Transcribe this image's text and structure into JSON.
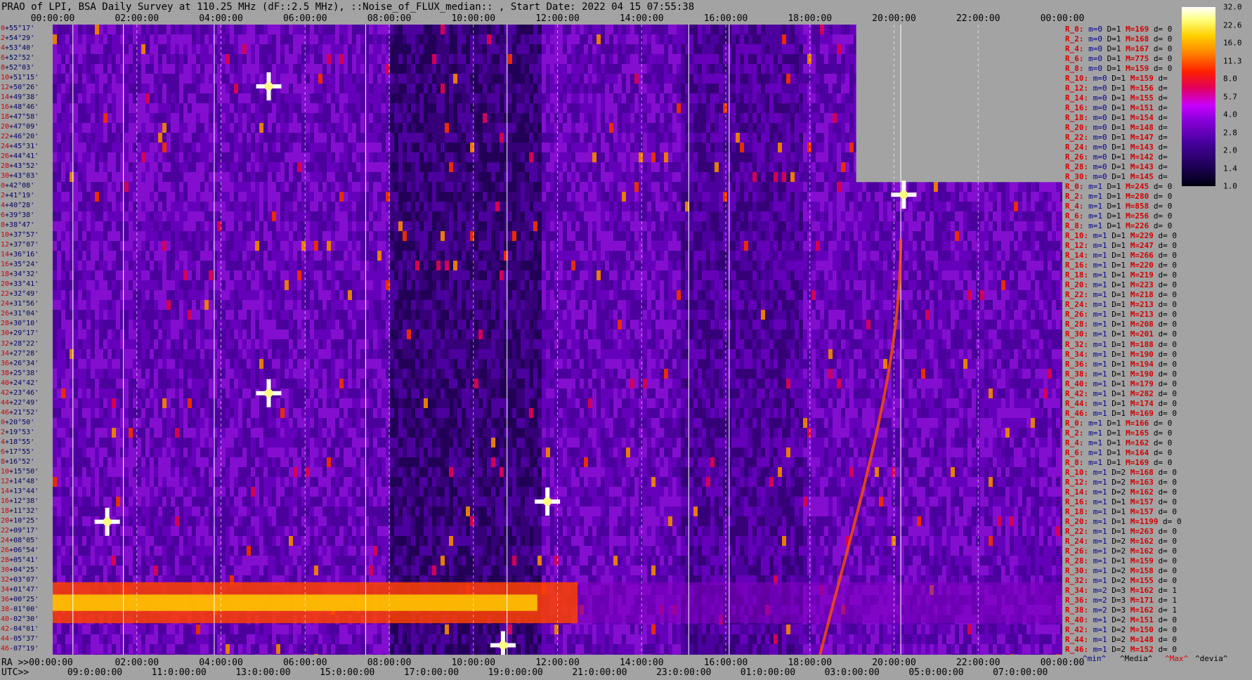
{
  "title": "PRAO of LPI, BSA Daily Survey at 110.25 MHz (dF::2.5 MHz), ::Noise_of_FLUX_median:: , Start Date: 2022 04 15 07:55:38",
  "top_ticks": [
    "00:00:00",
    "02:00:00",
    "04:00:00",
    "06:00:00",
    "08:00:00",
    "10:00:00",
    "12:00:00",
    "14:00:00",
    "16:00:00",
    "18:00:00",
    "20:00:00",
    "22:00:00",
    "00:00:00"
  ],
  "dec_labels": [
    {
      "i": "0",
      "d": "+55°17'"
    },
    {
      "i": "2",
      "d": "+54°29'"
    },
    {
      "i": "4",
      "d": "+53°40'"
    },
    {
      "i": "6",
      "d": "+52°52'"
    },
    {
      "i": "8",
      "d": "+52°03'"
    },
    {
      "i": "10",
      "d": "+51°15'"
    },
    {
      "i": "12",
      "d": "+50°26'"
    },
    {
      "i": "14",
      "d": "+49°38'"
    },
    {
      "i": "16",
      "d": "+48°46'"
    },
    {
      "i": "18",
      "d": "+47°58'"
    },
    {
      "i": "20",
      "d": "+47°09'"
    },
    {
      "i": "22",
      "d": "+46°20'"
    },
    {
      "i": "24",
      "d": "+45°31'"
    },
    {
      "i": "26",
      "d": "+44°41'"
    },
    {
      "i": "28",
      "d": "+43°52'"
    },
    {
      "i": "30",
      "d": "+43°03'"
    },
    {
      "i": "0",
      "d": "+42°08'"
    },
    {
      "i": "2",
      "d": "+41°19'"
    },
    {
      "i": "4",
      "d": "+40°28'"
    },
    {
      "i": "6",
      "d": "+39°38'"
    },
    {
      "i": "8",
      "d": "+38°47'"
    },
    {
      "i": "10",
      "d": "+37°57'"
    },
    {
      "i": "12",
      "d": "+37°07'"
    },
    {
      "i": "14",
      "d": "+36°16'"
    },
    {
      "i": "16",
      "d": "+35°24'"
    },
    {
      "i": "18",
      "d": "+34°32'"
    },
    {
      "i": "20",
      "d": "+33°41'"
    },
    {
      "i": "22",
      "d": "+32°49'"
    },
    {
      "i": "24",
      "d": "+31°56'"
    },
    {
      "i": "26",
      "d": "+31°04'"
    },
    {
      "i": "28",
      "d": "+30°10'"
    },
    {
      "i": "30",
      "d": "+29°17'"
    },
    {
      "i": "32",
      "d": "+28°22'"
    },
    {
      "i": "34",
      "d": "+27°28'"
    },
    {
      "i": "36",
      "d": "+26°34'"
    },
    {
      "i": "38",
      "d": "+25°38'"
    },
    {
      "i": "40",
      "d": "+24°42'"
    },
    {
      "i": "42",
      "d": "+23°46'"
    },
    {
      "i": "44",
      "d": "+22°49'"
    },
    {
      "i": "46",
      "d": "+21°52'"
    },
    {
      "i": "0",
      "d": "+20°50'"
    },
    {
      "i": "2",
      "d": "+19°53'"
    },
    {
      "i": "4",
      "d": "+18°55'"
    },
    {
      "i": "6",
      "d": "+17°55'"
    },
    {
      "i": "8",
      "d": "+16°52'"
    },
    {
      "i": "10",
      "d": "+15°50'"
    },
    {
      "i": "12",
      "d": "+14°48'"
    },
    {
      "i": "14",
      "d": "+13°44'"
    },
    {
      "i": "16",
      "d": "+12°38'"
    },
    {
      "i": "18",
      "d": "+11°32'"
    },
    {
      "i": "20",
      "d": "+10°25'"
    },
    {
      "i": "22",
      "d": "+09°17'"
    },
    {
      "i": "24",
      "d": "+08°05'"
    },
    {
      "i": "26",
      "d": "+06°54'"
    },
    {
      "i": "28",
      "d": "+05°41'"
    },
    {
      "i": "30",
      "d": "+04°25'"
    },
    {
      "i": "32",
      "d": "+03°07'"
    },
    {
      "i": "34",
      "d": "+01°47'"
    },
    {
      "i": "36",
      "d": "+00°25'"
    },
    {
      "i": "38",
      "d": "-01°00'"
    },
    {
      "i": "40",
      "d": "-02°30'"
    },
    {
      "i": "42",
      "d": "-04°01'"
    },
    {
      "i": "44",
      "d": "-05°37'"
    },
    {
      "i": "46",
      "d": "-07°19'"
    }
  ],
  "right_rows": [
    {
      "r": "R_0:",
      "m": "m=0",
      "d": "D=1",
      "x": "M=169",
      "e": "d= 0"
    },
    {
      "r": "R_2:",
      "m": "m=0",
      "d": "D=1",
      "x": "M=168",
      "e": "d= 0"
    },
    {
      "r": "R_4:",
      "m": "m=0",
      "d": "D=1",
      "x": "M=167",
      "e": "d= 0"
    },
    {
      "r": "R_6:",
      "m": "m=0",
      "d": "D=1",
      "x": "M=775",
      "e": "d= 0"
    },
    {
      "r": "R_8:",
      "m": "m=0",
      "d": "D=1",
      "x": "M=159",
      "e": "d= 0"
    },
    {
      "r": "R_10:",
      "m": "m=0",
      "d": "D=1",
      "x": "M=159",
      "e": "d="
    },
    {
      "r": "R_12:",
      "m": "m=0",
      "d": "D=1",
      "x": "M=156",
      "e": "d="
    },
    {
      "r": "R_14:",
      "m": "m=0",
      "d": "D=1",
      "x": "M=155",
      "e": "d="
    },
    {
      "r": "R_16:",
      "m": "m=0",
      "d": "D=1",
      "x": "M=151",
      "e": "d="
    },
    {
      "r": "R_18:",
      "m": "m=0",
      "d": "D=1",
      "x": "M=154",
      "e": "d="
    },
    {
      "r": "R_20:",
      "m": "m=0",
      "d": "D=1",
      "x": "M=148",
      "e": "d="
    },
    {
      "r": "R_22:",
      "m": "m=0",
      "d": "D=1",
      "x": "M=147",
      "e": "d="
    },
    {
      "r": "R_24:",
      "m": "m=0",
      "d": "D=1",
      "x": "M=143",
      "e": "d="
    },
    {
      "r": "R_26:",
      "m": "m=0",
      "d": "D=1",
      "x": "M=142",
      "e": "d="
    },
    {
      "r": "R_28:",
      "m": "m=0",
      "d": "D=1",
      "x": "M=143",
      "e": "d="
    },
    {
      "r": "R_30:",
      "m": "m=0",
      "d": "D=1",
      "x": "M=145",
      "e": "d="
    },
    {
      "r": "R_0:",
      "m": "m=1",
      "d": "D=1",
      "x": "M=245",
      "e": "d= 0"
    },
    {
      "r": "R_2:",
      "m": "m=1",
      "d": "D=1",
      "x": "M=280",
      "e": "d= 0"
    },
    {
      "r": "R_4:",
      "m": "m=1",
      "d": "D=1",
      "x": "M=858",
      "e": "d= 0"
    },
    {
      "r": "R_6:",
      "m": "m=1",
      "d": "D=1",
      "x": "M=256",
      "e": "d= 0"
    },
    {
      "r": "R_8:",
      "m": "m=1",
      "d": "D=1",
      "x": "M=226",
      "e": "d= 0"
    },
    {
      "r": "R_10:",
      "m": "m=1",
      "d": "D=1",
      "x": "M=229",
      "e": "d= 0"
    },
    {
      "r": "R_12:",
      "m": "m=1",
      "d": "D=1",
      "x": "M=247",
      "e": "d= 0"
    },
    {
      "r": "R_14:",
      "m": "m=1",
      "d": "D=1",
      "x": "M=266",
      "e": "d= 0"
    },
    {
      "r": "R_16:",
      "m": "m=1",
      "d": "D=1",
      "x": "M=220",
      "e": "d= 0"
    },
    {
      "r": "R_18:",
      "m": "m=1",
      "d": "D=1",
      "x": "M=219",
      "e": "d= 0"
    },
    {
      "r": "R_20:",
      "m": "m=1",
      "d": "D=1",
      "x": "M=223",
      "e": "d= 0"
    },
    {
      "r": "R_22:",
      "m": "m=1",
      "d": "D=1",
      "x": "M=218",
      "e": "d= 0"
    },
    {
      "r": "R_24:",
      "m": "m=1",
      "d": "D=1",
      "x": "M=213",
      "e": "d= 0"
    },
    {
      "r": "R_26:",
      "m": "m=1",
      "d": "D=1",
      "x": "M=213",
      "e": "d= 0"
    },
    {
      "r": "R_28:",
      "m": "m=1",
      "d": "D=1",
      "x": "M=208",
      "e": "d= 0"
    },
    {
      "r": "R_30:",
      "m": "m=1",
      "d": "D=1",
      "x": "M=201",
      "e": "d= 0"
    },
    {
      "r": "R_32:",
      "m": "m=1",
      "d": "D=1",
      "x": "M=188",
      "e": "d= 0"
    },
    {
      "r": "R_34:",
      "m": "m=1",
      "d": "D=1",
      "x": "M=190",
      "e": "d= 0"
    },
    {
      "r": "R_36:",
      "m": "m=1",
      "d": "D=1",
      "x": "M=194",
      "e": "d= 0"
    },
    {
      "r": "R_38:",
      "m": "m=1",
      "d": "D=1",
      "x": "M=190",
      "e": "d= 0"
    },
    {
      "r": "R_40:",
      "m": "m=1",
      "d": "D=1",
      "x": "M=179",
      "e": "d= 0"
    },
    {
      "r": "R_42:",
      "m": "m=1",
      "d": "D=1",
      "x": "M=282",
      "e": "d= 0"
    },
    {
      "r": "R_44:",
      "m": "m=1",
      "d": "D=1",
      "x": "M=174",
      "e": "d= 0"
    },
    {
      "r": "R_46:",
      "m": "m=1",
      "d": "D=1",
      "x": "M=169",
      "e": "d= 0"
    },
    {
      "r": "R_0:",
      "m": "m=1",
      "d": "D=1",
      "x": "M=166",
      "e": "d= 0"
    },
    {
      "r": "R_2:",
      "m": "m=1",
      "d": "D=1",
      "x": "M=165",
      "e": "d= 0"
    },
    {
      "r": "R_4:",
      "m": "m=1",
      "d": "D=1",
      "x": "M=162",
      "e": "d= 0"
    },
    {
      "r": "R_6:",
      "m": "m=1",
      "d": "D=1",
      "x": "M=164",
      "e": "d= 0"
    },
    {
      "r": "R_8:",
      "m": "m=1",
      "d": "D=1",
      "x": "M=169",
      "e": "d= 0"
    },
    {
      "r": "R_10:",
      "m": "m=1",
      "d": "D=2",
      "x": "M=168",
      "e": "d= 0"
    },
    {
      "r": "R_12:",
      "m": "m=1",
      "d": "D=2",
      "x": "M=163",
      "e": "d= 0"
    },
    {
      "r": "R_14:",
      "m": "m=1",
      "d": "D=2",
      "x": "M=162",
      "e": "d= 0"
    },
    {
      "r": "R_16:",
      "m": "m=1",
      "d": "D=1",
      "x": "M=157",
      "e": "d= 0"
    },
    {
      "r": "R_18:",
      "m": "m=1",
      "d": "D=1",
      "x": "M=157",
      "e": "d= 0"
    },
    {
      "r": "R_20:",
      "m": "m=1",
      "d": "D=1",
      "x": "M=1199",
      "e": "d= 0"
    },
    {
      "r": "R_22:",
      "m": "m=1",
      "d": "D=1",
      "x": "M=263",
      "e": "d= 0"
    },
    {
      "r": "R_24:",
      "m": "m=1",
      "d": "D=2",
      "x": "M=162",
      "e": "d= 0"
    },
    {
      "r": "R_26:",
      "m": "m=1",
      "d": "D=2",
      "x": "M=162",
      "e": "d= 0"
    },
    {
      "r": "R_28:",
      "m": "m=1",
      "d": "D=1",
      "x": "M=159",
      "e": "d= 0"
    },
    {
      "r": "R_30:",
      "m": "m=1",
      "d": "D=2",
      "x": "M=158",
      "e": "d= 0"
    },
    {
      "r": "R_32:",
      "m": "m=1",
      "d": "D=2",
      "x": "M=155",
      "e": "d= 0"
    },
    {
      "r": "R_34:",
      "m": "m=2",
      "d": "D=3",
      "x": "M=162",
      "e": "d= 1"
    },
    {
      "r": "R_36:",
      "m": "m=2",
      "d": "D=3",
      "x": "M=171",
      "e": "d= 1"
    },
    {
      "r": "R_38:",
      "m": "m=2",
      "d": "D=3",
      "x": "M=162",
      "e": "d= 1"
    },
    {
      "r": "R_40:",
      "m": "m=1",
      "d": "D=2",
      "x": "M=151",
      "e": "d= 0"
    },
    {
      "r": "R_42:",
      "m": "m=1",
      "d": "D=2",
      "x": "M=150",
      "e": "d= 0"
    },
    {
      "r": "R_44:",
      "m": "m=1",
      "d": "D=2",
      "x": "M=148",
      "e": "d= 0"
    },
    {
      "r": "R_46:",
      "m": "m=1",
      "d": "D=2",
      "x": "M=152",
      "e": "d= 0"
    }
  ],
  "colorbar_labels": [
    "32.0",
    "22.6",
    "16.0",
    "11.3",
    "8.0",
    "5.7",
    "4.0",
    "2.8",
    "2.0",
    "1.4",
    "1.0"
  ],
  "bottom": {
    "ra_label": "RA >>00:00:00",
    "utc_label": "UTC>>",
    "ra_ticks": [
      "02:00:00",
      "04:00:00",
      "06:00:00",
      "08:00:00",
      "10:00:00",
      "12:00:00",
      "14:00:00",
      "16:00:00",
      "18:00:00",
      "20:00:00",
      "22:00:00",
      "00:00:00"
    ],
    "utc_ticks": [
      "09:0:00:00",
      "11:0:00:00",
      "13:0:00:00",
      "15:0:00:00",
      "17:0:00:00",
      "19:0:00:00",
      "21:0:00:00",
      "23:0:00:00",
      "01:0:00:00",
      "03:0:00:00",
      "05:0:00:00",
      "07:0:00:00"
    ]
  },
  "legend": {
    "min": "^min^",
    "median": "^Media^",
    "max": "^Max^",
    "dev": "^devia^"
  },
  "colors": {
    "min": "#000090",
    "median": "#000000",
    "max": "#d40000",
    "dev": "#000000"
  },
  "chart_data": {
    "type": "heatmap",
    "title": "PRAO of LPI, BSA Daily Survey at 110.25 MHz (dF::2.5 MHz), ::Noise_of_FLUX_median:: , Start Date: 2022 04 15 07:55:38",
    "x_axis_ra": [
      "00:00:00",
      "02:00:00",
      "04:00:00",
      "06:00:00",
      "08:00:00",
      "10:00:00",
      "12:00:00",
      "14:00:00",
      "16:00:00",
      "18:00:00",
      "20:00:00",
      "22:00:00",
      "00:00:00"
    ],
    "y_axis_declination_range": [
      "+55°17'",
      "-07°19'"
    ],
    "colorbar_range": [
      1.0,
      32.0
    ],
    "colorbar_scale": "log2",
    "colorbar_ticks": [
      32.0,
      22.6,
      16.0,
      11.3,
      8.0,
      5.7,
      4.0,
      2.8,
      2.0,
      1.4,
      1.0
    ],
    "colormap": "black-purple-magenta-red-orange-yellow-white",
    "bright_sources": [
      {
        "ra": "01:35",
        "dec": "+10°25'"
      },
      {
        "ra": "05:30",
        "dec": "+50°00'"
      },
      {
        "ra": "05:30",
        "dec": "+22°00'"
      },
      {
        "ra": "19:59",
        "dec": "+40°44'"
      },
      {
        "ra": "12:30",
        "dec": "+12°24'"
      },
      {
        "ra": "11:15",
        "dec": "-05°37'"
      }
    ],
    "bright_band_dec_range": [
      "+01°47'",
      "-02°30'"
    ],
    "missing_data": {
      "ra_range": [
        "19:00:00",
        "00:00:00"
      ],
      "dec_range": [
        "+55°17'",
        "+43°03'"
      ]
    }
  }
}
